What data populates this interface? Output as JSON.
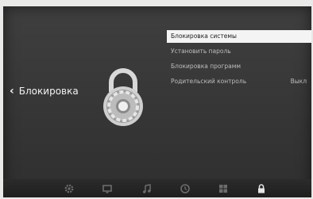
{
  "header": {
    "title": "Блокировка"
  },
  "menu": {
    "items": [
      {
        "label": "Блокировка системы",
        "selected": true
      },
      {
        "label": "Установить пароль"
      },
      {
        "label": "Блокировка программ"
      },
      {
        "label": "Родительский контроль",
        "value": "Выкл"
      }
    ]
  },
  "dock": {
    "icons": [
      "gear-icon",
      "tv-icon",
      "music-note-icon",
      "clock-icon",
      "grid-icon",
      "lock-icon"
    ]
  },
  "colors": {
    "menu_selected_bg": "#f4f4f4",
    "screen_bg": "#3a3a3a"
  }
}
